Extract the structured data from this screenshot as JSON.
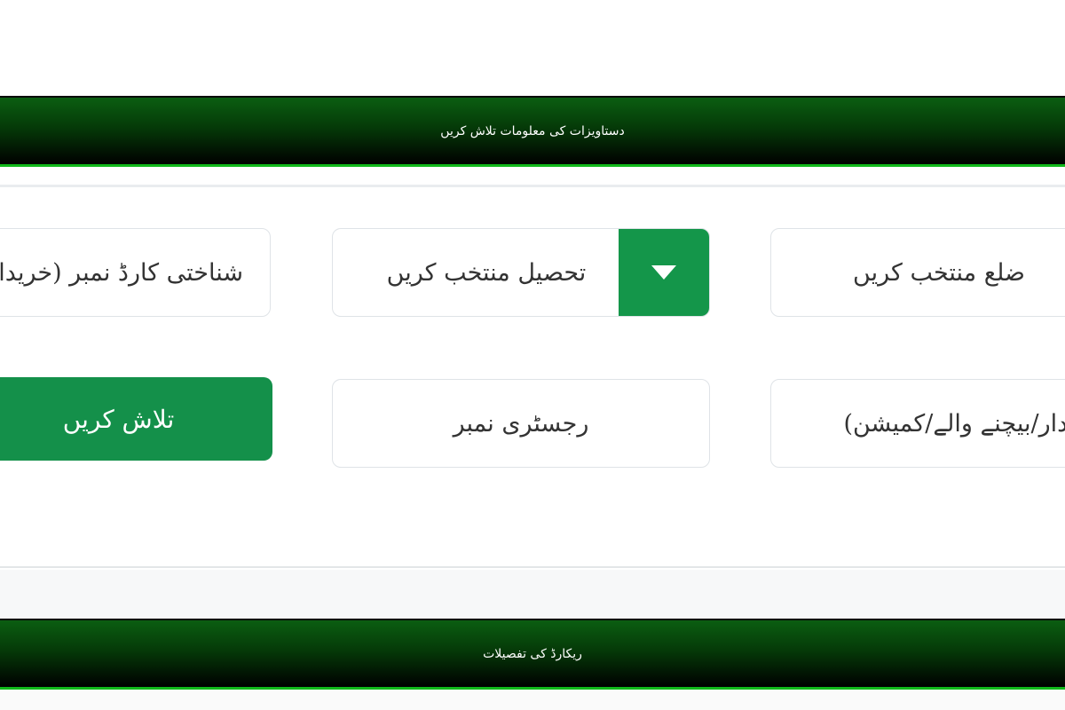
{
  "sections": {
    "search_header": "دستاویزات کی معلومات تلاش کریں",
    "records_header": "ریکارڈ کی تفصیلات"
  },
  "form": {
    "district_select": "ضلع منتخب کریں",
    "tehsil_select": "تحصیل منتخب کریں",
    "cnic_field": "شناختی کارڈ نمبر (خریدار/بیچنے",
    "name_field": "(خریدار/بیچنے والے/کمیشن)",
    "registry_field": "رجسٹری نمبر",
    "search_button": "تلاش کریں"
  },
  "colors": {
    "band_green": "#0b5e11",
    "band_accent": "#10b81a",
    "button_green": "#14964a"
  },
  "icons": {
    "dropdown": "caret-down-icon"
  }
}
